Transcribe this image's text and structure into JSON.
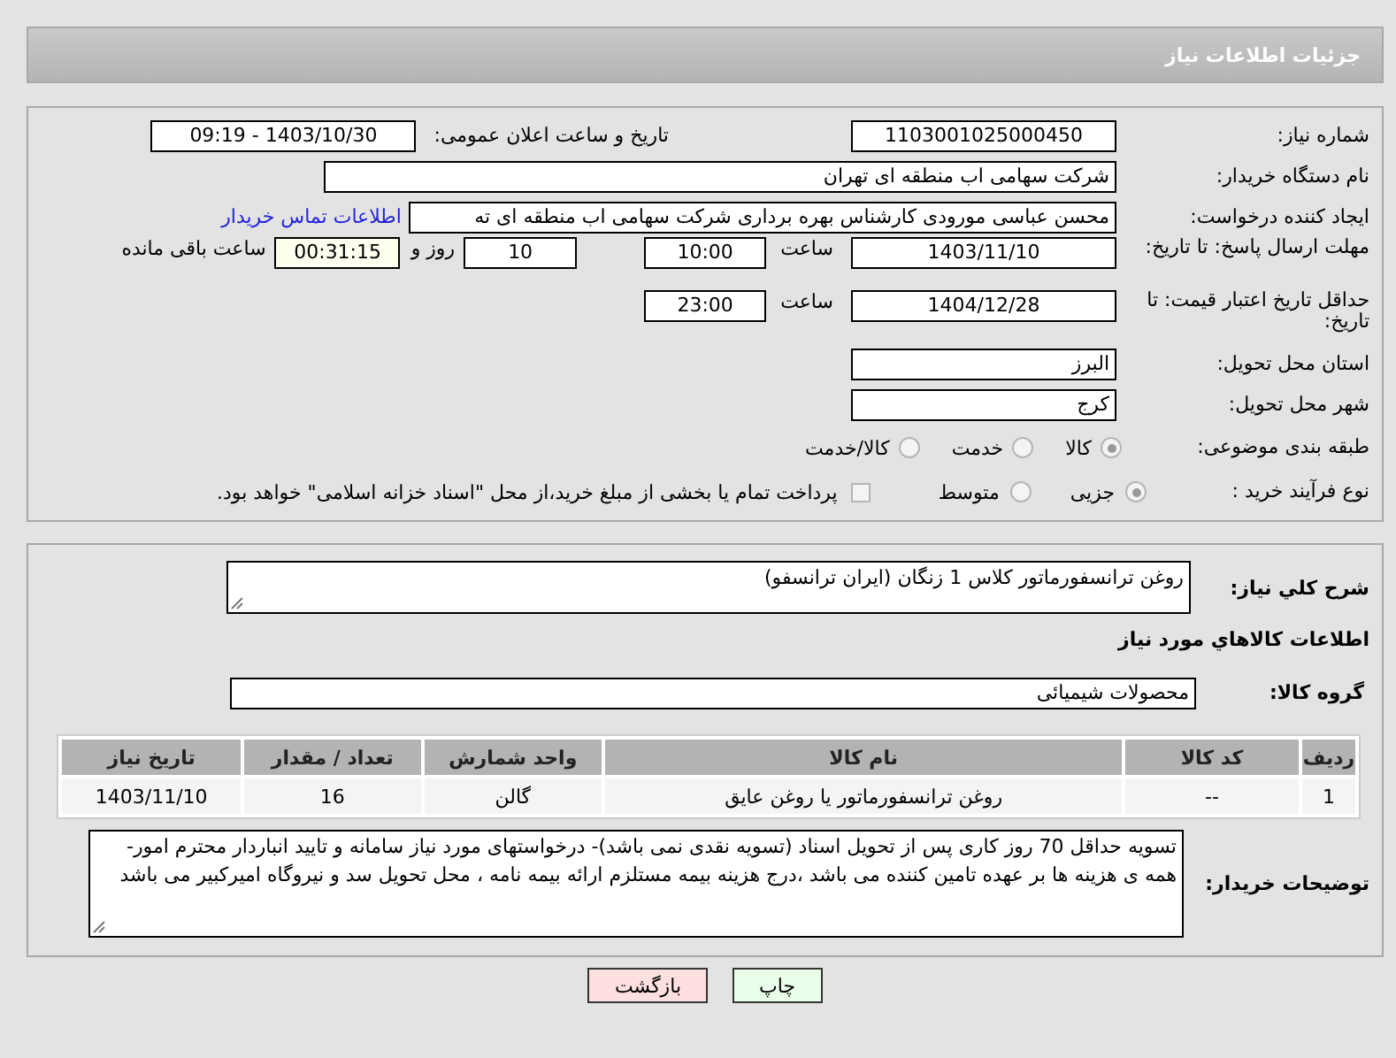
{
  "header": {
    "title": "جزئیات اطلاعات نیاز"
  },
  "general": {
    "need_number": {
      "label": "شماره نیاز:",
      "value": "1103001025000450"
    },
    "announce": {
      "label": "تاریخ و ساعت اعلان عمومی:",
      "value": "1403/10/30 - 09:19"
    },
    "buyer_org": {
      "label": "نام دستگاه خریدار:",
      "value": "شرکت سهامی اب منطقه ای تهران"
    },
    "requester": {
      "label": "ایجاد کننده درخواست:",
      "value": "محسن عباسی مورودی کارشناس بهره برداری شرکت سهامی اب منطقه ای ته",
      "link": "اطلاعات تماس خریدار"
    },
    "reply_deadline": {
      "label": "مهلت ارسال پاسخ: تا تاریخ:",
      "date": "1403/11/10",
      "time_label": "ساعت",
      "time": "10:00",
      "days": "10",
      "days_label": "روز و",
      "remaining": "00:31:15",
      "remaining_label": "ساعت باقی مانده"
    },
    "price_validity": {
      "label": "حداقل تاریخ اعتبار قیمت: تا تاریخ:",
      "date": "1404/12/28",
      "time_label": "ساعت",
      "time": "23:00"
    },
    "province": {
      "label": "استان محل تحویل:",
      "value": "البرز"
    },
    "city": {
      "label": "شهر محل تحویل:",
      "value": "کرج"
    },
    "category": {
      "label": "طبقه بندی موضوعی:",
      "options": [
        {
          "label": "کالا",
          "selected": true
        },
        {
          "label": "خدمت",
          "selected": false
        },
        {
          "label": "کالا/خدمت",
          "selected": false
        }
      ]
    },
    "process": {
      "label": "نوع فرآیند خرید :",
      "options": [
        {
          "label": "جزیی",
          "selected": true
        },
        {
          "label": "متوسط",
          "selected": false
        }
      ],
      "payment_option": {
        "label": "پرداخت تمام یا بخشی از مبلغ خرید،از محل \"اسناد خزانه اسلامی\" خواهد بود.",
        "checked": false
      }
    }
  },
  "details": {
    "summary": {
      "label": "شرح کلي نياز:",
      "value": "روغن ترانسفورماتور کلاس 1 زنگان (ایران ترانسفو)"
    },
    "goods_heading": "اطلاعات کالاهاي مورد نياز",
    "group": {
      "label": "گروه کالا:",
      "value": "محصولات شیمیائی"
    },
    "table": {
      "columns": [
        "رديف",
        "کد کالا",
        "نام کالا",
        "واحد شمارش",
        "تعداد / مقدار",
        "تاریخ نیاز"
      ],
      "rows": [
        [
          "1",
          "--",
          "روغن ترانسفورماتور یا روغن عایق",
          "گالن",
          "16",
          "1403/11/10"
        ]
      ]
    },
    "buyer_notes": {
      "label": "توضیحات خریدار:",
      "value": "تسویه حداقل 70 روز کاری پس از تحویل اسناد (تسویه نقدی نمی باشد)- درخواستهای مورد نیاز سامانه و تایید انباردار محترم امور- همه ی هزینه ها بر عهده تامین کننده می باشد ،درج هزینه بیمه مستلزم ارائه بیمه نامه ، محل تحویل سد و نیروگاه امیرکبیر می باشد"
    }
  },
  "buttons": [
    {
      "label": "چاپ",
      "kind": "print"
    },
    {
      "label": "بازگشت",
      "kind": "back"
    }
  ]
}
